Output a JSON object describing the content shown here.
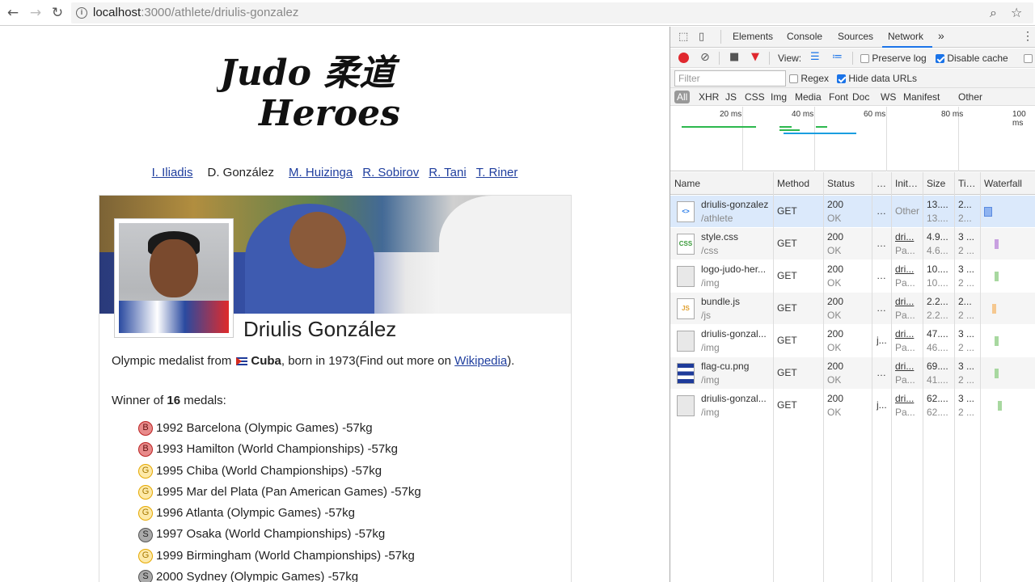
{
  "browser": {
    "url_host": "localhost",
    "url_path": ":3000/athlete/driulis-gonzalez",
    "back_icon": "←",
    "forward_icon": "→",
    "reload_icon": "↻",
    "info_icon": "i",
    "zoom_icon": "⌕",
    "star_icon": "☆"
  },
  "page": {
    "logo_line1": "Judo 柔道",
    "logo_line2": "Heroes",
    "nav": [
      {
        "label": "I. Iliadis",
        "link": true
      },
      {
        "label": "D. González",
        "link": false
      },
      {
        "label": "M. Huizinga",
        "link": true
      },
      {
        "label": "R. Sobirov",
        "link": true
      },
      {
        "label": "R. Tani",
        "link": true
      },
      {
        "label": "T. Riner",
        "link": true
      }
    ],
    "athlete": {
      "name": "Driulis González",
      "bio_prefix": "Olympic medalist from",
      "country": "Cuba",
      "bio_born": ", born in 1973(Find out more on ",
      "wiki_label": "Wikipedia",
      "bio_suffix": ").",
      "winner_prefix": "Winner of ",
      "medal_count": "16",
      "winner_suffix": " medals:",
      "medals": [
        {
          "type": "B",
          "text": "1992 Barcelona (Olympic Games) -57kg"
        },
        {
          "type": "B",
          "text": "1993 Hamilton (World Championships) -57kg"
        },
        {
          "type": "G",
          "text": "1995 Chiba (World Championships) -57kg"
        },
        {
          "type": "G",
          "text": "1995 Mar del Plata (Pan American Games) -57kg"
        },
        {
          "type": "G",
          "text": "1996 Atlanta (Olympic Games) -57kg"
        },
        {
          "type": "S",
          "text": "1997 Osaka (World Championships) -57kg"
        },
        {
          "type": "G",
          "text": "1999 Birmingham (World Championships) -57kg"
        },
        {
          "type": "S",
          "text": "2000 Sydney (Olympic Games) -57kg"
        }
      ]
    }
  },
  "devtools": {
    "tabs": [
      "Elements",
      "Console",
      "Sources",
      "Network"
    ],
    "active_tab": "Network",
    "more_icon": "»",
    "menu_icon": "⋮",
    "toolbar": {
      "view_label": "View:",
      "preserve_log": "Preserve log",
      "disable_cache": "Disable cache"
    },
    "filter": {
      "placeholder": "Filter",
      "regex": "Regex",
      "hide_data_urls": "Hide data URLs"
    },
    "types": [
      "All",
      "XHR",
      "JS",
      "CSS",
      "Img",
      "Media",
      "Font",
      "Doc",
      "WS",
      "Manifest",
      "Other"
    ],
    "overview_labels": [
      "20 ms",
      "40 ms",
      "60 ms",
      "80 ms",
      "100 ms"
    ],
    "columns": [
      "Name",
      "Method",
      "Status",
      "…",
      "Init…",
      "Size",
      "Ti…",
      "Waterfall"
    ],
    "rows": [
      {
        "name": "driulis-gonzalez",
        "sub": "/athlete",
        "icon": "<>",
        "method": "GET",
        "status": "200",
        "status_text": "OK",
        "type": "…",
        "init": "Other",
        "init_sub": "",
        "size": "13....",
        "size_sub": "13....",
        "time": "2...",
        "time_sub": "2...",
        "wf_color": "#8fb3f0"
      },
      {
        "name": "style.css",
        "sub": "/css",
        "icon": "CSS",
        "method": "GET",
        "status": "200",
        "status_text": "OK",
        "type": "…",
        "init": "dri...",
        "init_sub": "Pa...",
        "size": "4.9...",
        "size_sub": "4.6...",
        "time": "3 ...",
        "time_sub": "2 ...",
        "wf_color": "#c8a0e0"
      },
      {
        "name": "logo-judo-her...",
        "sub": "/img",
        "icon": "img",
        "method": "GET",
        "status": "200",
        "status_text": "OK",
        "type": "…",
        "init": "dri...",
        "init_sub": "Pa...",
        "size": "10....",
        "size_sub": "10....",
        "time": "3 ...",
        "time_sub": "2 ...",
        "wf_color": "#a8d8a0"
      },
      {
        "name": "bundle.js",
        "sub": "/js",
        "icon": "JS",
        "method": "GET",
        "status": "200",
        "status_text": "OK",
        "type": "…",
        "init": "dri...",
        "init_sub": "Pa...",
        "size": "2.2...",
        "size_sub": "2.2...",
        "time": "2...",
        "time_sub": "2 ...",
        "wf_color": "#f5c890"
      },
      {
        "name": "driulis-gonzal...",
        "sub": "/img",
        "icon": "img",
        "method": "GET",
        "status": "200",
        "status_text": "OK",
        "type": "j...",
        "init": "dri...",
        "init_sub": "Pa...",
        "size": "47....",
        "size_sub": "46....",
        "time": "3 ...",
        "time_sub": "2 ...",
        "wf_color": "#a8d8a0"
      },
      {
        "name": "flag-cu.png",
        "sub": "/img",
        "icon": "flag",
        "method": "GET",
        "status": "200",
        "status_text": "OK",
        "type": "…",
        "init": "dri...",
        "init_sub": "Pa...",
        "size": "69....",
        "size_sub": "41....",
        "time": "3 ...",
        "time_sub": "2 ...",
        "wf_color": "#a8d8a0"
      },
      {
        "name": "driulis-gonzal...",
        "sub": "/img",
        "icon": "img",
        "method": "GET",
        "status": "200",
        "status_text": "OK",
        "type": "j...",
        "init": "dri...",
        "init_sub": "Pa...",
        "size": "62....",
        "size_sub": "62....",
        "time": "3 ...",
        "time_sub": "2 ...",
        "wf_color": "#a8d8a0"
      }
    ]
  }
}
